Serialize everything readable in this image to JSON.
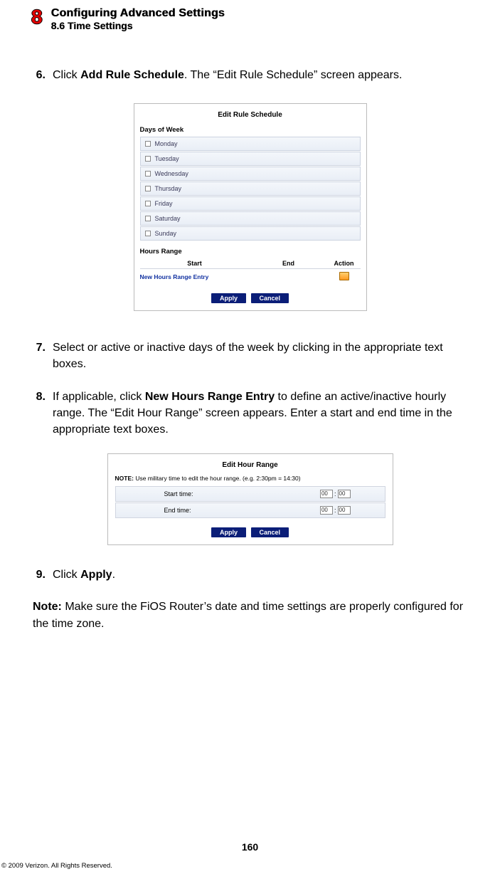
{
  "header": {
    "chapter_number": "8",
    "chapter_title": "Configuring Advanced Settings",
    "subsection": "8.6  Time Settings"
  },
  "steps": {
    "s6": {
      "num": "6.",
      "pre": "Click ",
      "bold": "Add Rule Schedule",
      "post": ". The “Edit Rule Schedule” screen appears."
    },
    "s7": {
      "num": "7.",
      "text": "Select or active or inactive days of the week by clicking in the appropriate text boxes."
    },
    "s8": {
      "num": "8.",
      "pre": "If applicable, click ",
      "bold": "New Hours Range Entry",
      "post": " to define an active/inactive hourly range. The “Edit Hour Range” screen appears. Enter a start and end time in the appropriate text boxes."
    },
    "s9": {
      "num": "9.",
      "pre": "Click ",
      "bold": "Apply",
      "post": "."
    }
  },
  "note": {
    "label": "Note:",
    "text": " Make sure the FiOS Router’s date and time settings are properly configured for the time zone."
  },
  "panel1": {
    "title": "Edit Rule Schedule",
    "days_label": "Days of Week",
    "days": [
      "Monday",
      "Tuesday",
      "Wednesday",
      "Thursday",
      "Friday",
      "Saturday",
      "Sunday"
    ],
    "hours_label": "Hours Range",
    "col_start": "Start",
    "col_end": "End",
    "col_action": "Action",
    "new_entry": "New Hours Range Entry",
    "btn_apply": "Apply",
    "btn_cancel": "Cancel"
  },
  "panel2": {
    "title": "Edit Hour Range",
    "note_bold": "NOTE:",
    "note_text": " Use military time to edit the hour range. (e.g. 2:30pm = 14:30)",
    "start_label": "Start time:",
    "end_label": "End time:",
    "val": "00",
    "sep": ":",
    "btn_apply": "Apply",
    "btn_cancel": "Cancel"
  },
  "page_number": "160",
  "copyright": "© 2009 Verizon. All Rights Reserved."
}
